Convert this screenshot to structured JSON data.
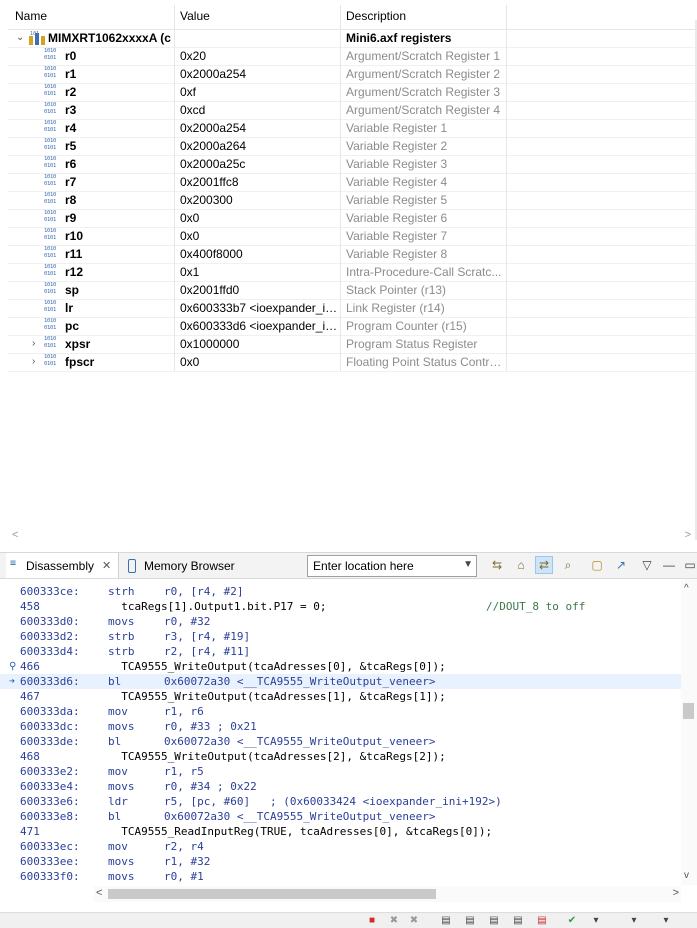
{
  "registers": {
    "columns": {
      "name": "Name",
      "value": "Value",
      "description": "Description"
    },
    "group": {
      "name": "MIMXRT1062xxxxA (c",
      "description": "Mini6.axf registers"
    },
    "rows": [
      {
        "name": "r0",
        "value": "0x20",
        "description": "Argument/Scratch Register 1"
      },
      {
        "name": "r1",
        "value": "0x2000a254",
        "description": "Argument/Scratch Register 2"
      },
      {
        "name": "r2",
        "value": "0xf",
        "description": "Argument/Scratch Register 3"
      },
      {
        "name": "r3",
        "value": "0xcd",
        "description": "Argument/Scratch Register 4"
      },
      {
        "name": "r4",
        "value": "0x2000a254",
        "description": "Variable Register 1"
      },
      {
        "name": "r5",
        "value": "0x2000a264",
        "description": "Variable Register 2"
      },
      {
        "name": "r6",
        "value": "0x2000a25c",
        "description": "Variable Register 3"
      },
      {
        "name": "r7",
        "value": "0x2001ffc8",
        "description": "Variable Register 4"
      },
      {
        "name": "r8",
        "value": "0x200300",
        "description": "Variable Register 5"
      },
      {
        "name": "r9",
        "value": "0x0",
        "description": "Variable Register 6"
      },
      {
        "name": "r10",
        "value": "0x0",
        "description": "Variable Register 7"
      },
      {
        "name": "r11",
        "value": "0x400f8000",
        "description": "Variable Register 8"
      },
      {
        "name": "r12",
        "value": "0x1",
        "description": "Intra-Procedure-Call Scratc..."
      },
      {
        "name": "sp",
        "value": "0x2001ffd0",
        "description": "Stack Pointer (r13)"
      },
      {
        "name": "lr",
        "value": "0x600333b7 <ioexpander_ini...",
        "description": "Link Register (r14)"
      },
      {
        "name": "pc",
        "value": "0x600333d6 <ioexpander_ini...",
        "description": "Program Counter (r15)"
      },
      {
        "name": "xpsr",
        "value": "0x1000000",
        "description": "Program Status Register"
      },
      {
        "name": "fpscr",
        "value": "0x0",
        "description": "Floating Point Status Contro..."
      }
    ]
  },
  "disassembly": {
    "tab_label": "Disassembly",
    "tab_close": "✕",
    "memory_tab_label": "Memory Browser",
    "location_value": "Enter location here",
    "lines": [
      {
        "addr": "600333ce:",
        "mn": "strh",
        "ops": "r0, [r4, #2]"
      },
      {
        "addr": "458",
        "src": "  tcaRegs[1].Output1.bit.P17 = 0;",
        "cmt": "//DOUT_8 to off"
      },
      {
        "addr": "600333d0:",
        "mn": "movs",
        "ops": "r0, #32"
      },
      {
        "addr": "600333d2:",
        "mn": "strb",
        "ops": "r3, [r4, #19]"
      },
      {
        "addr": "600333d4:",
        "mn": "strb",
        "ops": "r2, [r4, #11]"
      },
      {
        "addr": "466",
        "src": "  TCA9555_WriteOutput(tcaAdresses[0], &tcaRegs[0]);"
      },
      {
        "addr": "600333d6:",
        "mn": "bl",
        "ops": "0x60072a30 <__TCA9555_WriteOutput_veneer>"
      },
      {
        "addr": "467",
        "src": "  TCA9555_WriteOutput(tcaAdresses[1], &tcaRegs[1]);"
      },
      {
        "addr": "600333da:",
        "mn": "mov",
        "ops": "r1, r6"
      },
      {
        "addr": "600333dc:",
        "mn": "movs",
        "ops": "r0, #33 ; 0x21"
      },
      {
        "addr": "600333de:",
        "mn": "bl",
        "ops": "0x60072a30 <__TCA9555_WriteOutput_veneer>"
      },
      {
        "addr": "468",
        "src": "  TCA9555_WriteOutput(tcaAdresses[2], &tcaRegs[2]);"
      },
      {
        "addr": "600333e2:",
        "mn": "mov",
        "ops": "r1, r5"
      },
      {
        "addr": "600333e4:",
        "mn": "movs",
        "ops": "r0, #34 ; 0x22"
      },
      {
        "addr": "600333e6:",
        "mn": "ldr",
        "ops": "r5, [pc, #60]   ; (0x60033424 <ioexpander_ini+192>)"
      },
      {
        "addr": "600333e8:",
        "mn": "bl",
        "ops": "0x60072a30 <__TCA9555_WriteOutput_veneer>"
      },
      {
        "addr": "471",
        "src": "  TCA9555_ReadInputReg(TRUE, tcaAdresses[0], &tcaRegs[0]);"
      },
      {
        "addr": "600333ec:",
        "mn": "mov",
        "ops": "r2, r4"
      },
      {
        "addr": "600333ee:",
        "mn": "movs",
        "ops": "r1, #32"
      },
      {
        "addr": "600333f0:",
        "mn": "movs",
        "ops": "r0, #1"
      }
    ],
    "toolbar_icons": [
      "link-icon",
      "home-icon",
      "sync-icon",
      "search-icon",
      "new-view-icon",
      "export-icon",
      "view-menu-icon",
      "minimize-icon",
      "maximize-icon"
    ]
  },
  "colors": {
    "accent": "#2a3f9a",
    "highlight": "#e8f2fe",
    "comment": "#3a7a4a",
    "desc": "#8c8c8c"
  }
}
